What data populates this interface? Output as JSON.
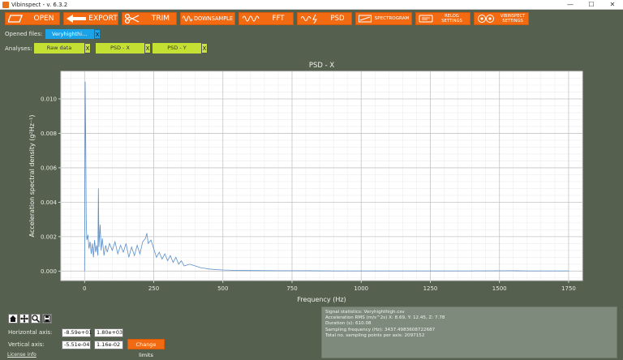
{
  "window": {
    "title": "Vibinspect - v. 6.3.2",
    "min": "—",
    "max": "☐",
    "close": "✕"
  },
  "toolbar": {
    "open": "OPEN",
    "export": "EXPORT",
    "trim": "TRIM",
    "downsample": "DOWNSAMPLE",
    "fft": "FFT",
    "psd": "PSD",
    "spectrogram": "SPECTROGRAM",
    "relog_l1": "RELOG",
    "relog_l2": "SETTINGS",
    "vib_l1": "VIBINSPECT",
    "vib_l2": "SETTINGS"
  },
  "files": {
    "label": "Opened files:",
    "tabs": [
      {
        "name": "Veryhighthi...",
        "close": "X"
      }
    ]
  },
  "analyses": {
    "label": "Analyses:",
    "tabs": [
      {
        "name": "Raw data",
        "close": "X"
      },
      {
        "name": "PSD - X",
        "close": "X"
      },
      {
        "name": "PSD - Y",
        "close": "X"
      }
    ]
  },
  "colors": {
    "accent": "#f26a12",
    "file_tab": "#1aa3e8",
    "analysis_tab": "#c4e032",
    "line": "#5b8fc9",
    "background": "#56604f"
  },
  "icons": [
    "open-icon",
    "export-arrow-icon",
    "scissors-icon",
    "downsample-wave-icon",
    "fft-wave-icon",
    "psd-wave-icon",
    "spectrogram-icon",
    "relog-settings-icon",
    "vibinspect-gear-icon",
    "home-icon",
    "pan-icon",
    "zoom-icon",
    "save-icon"
  ],
  "chart_data": {
    "type": "line",
    "title": "PSD - X",
    "xlabel": "Frequency (Hz)",
    "ylabel": "Acceleration spectral density (g²Hz⁻¹)",
    "xlim": [
      -85.9,
      1800
    ],
    "ylim": [
      -0.00055,
      0.0116
    ],
    "xticks": [
      0,
      250,
      500,
      750,
      1000,
      1250,
      1500,
      1750
    ],
    "yticks": [
      0.0,
      0.002,
      0.004,
      0.006,
      0.008,
      0.01
    ],
    "ytick_labels": [
      "0.000",
      "0.002",
      "0.004",
      "0.006",
      "0.008",
      "0.010"
    ],
    "grid": true,
    "series": [
      {
        "x": [
          0,
          2,
          4,
          6,
          8,
          12,
          16,
          20,
          24,
          28,
          32,
          36,
          40,
          44,
          48,
          50,
          52,
          56,
          60,
          64,
          70,
          76,
          82,
          90,
          100,
          110,
          120,
          130,
          140,
          150,
          160,
          170,
          180,
          190,
          200,
          210,
          220,
          225,
          230,
          240,
          250,
          260,
          270,
          280,
          290,
          300,
          310,
          320,
          330,
          340,
          350,
          360,
          380,
          400,
          420,
          450,
          480,
          500,
          550,
          600,
          700,
          800,
          900,
          1000,
          1200,
          1400,
          1550,
          1600,
          1700,
          1750
        ],
        "y": [
          0.0,
          0.011,
          0.0075,
          0.003,
          0.0018,
          0.0021,
          0.0013,
          0.0017,
          0.001,
          0.0016,
          0.0008,
          0.0018,
          0.0011,
          0.0015,
          0.0009,
          0.0048,
          0.0014,
          0.0027,
          0.0012,
          0.0019,
          0.0009,
          0.0015,
          0.0011,
          0.0016,
          0.0012,
          0.0017,
          0.001,
          0.0015,
          0.0011,
          0.0016,
          0.0008,
          0.0014,
          0.0009,
          0.0015,
          0.001,
          0.0017,
          0.0019,
          0.0022,
          0.0016,
          0.0018,
          0.0013,
          0.0008,
          0.0011,
          0.0007,
          0.001,
          0.0006,
          0.0009,
          0.0005,
          0.0008,
          0.0004,
          0.0006,
          0.0003,
          0.0004,
          0.0003,
          0.0002,
          0.00012,
          8e-05,
          6e-05,
          4e-05,
          3e-05,
          2e-05,
          2e-05,
          1e-05,
          1e-05,
          1e-05,
          1e-05,
          2e-05,
          1e-05,
          1e-05,
          1e-05
        ]
      }
    ]
  },
  "axes_controls": {
    "h_label": "Horizontal axis:",
    "h_min": "-8.59e+01",
    "h_max": "1.80e+03",
    "v_label": "Vertical axis:",
    "v_min": "-5.51e-04",
    "v_max": "1.16e-02",
    "change": "Change limits"
  },
  "license": "License info",
  "stats": {
    "lines": [
      "Signal statistics: Veryhighthigh.csv",
      "Acceleration RMS (m/s^2s) X: 8.69, Y: 12.45, Z: 7.78",
      "Duration (s): 610.08",
      "Sampling frequency (Hz): 3437.4983608722687",
      "Total no. sampling points per axis: 2097152"
    ]
  }
}
